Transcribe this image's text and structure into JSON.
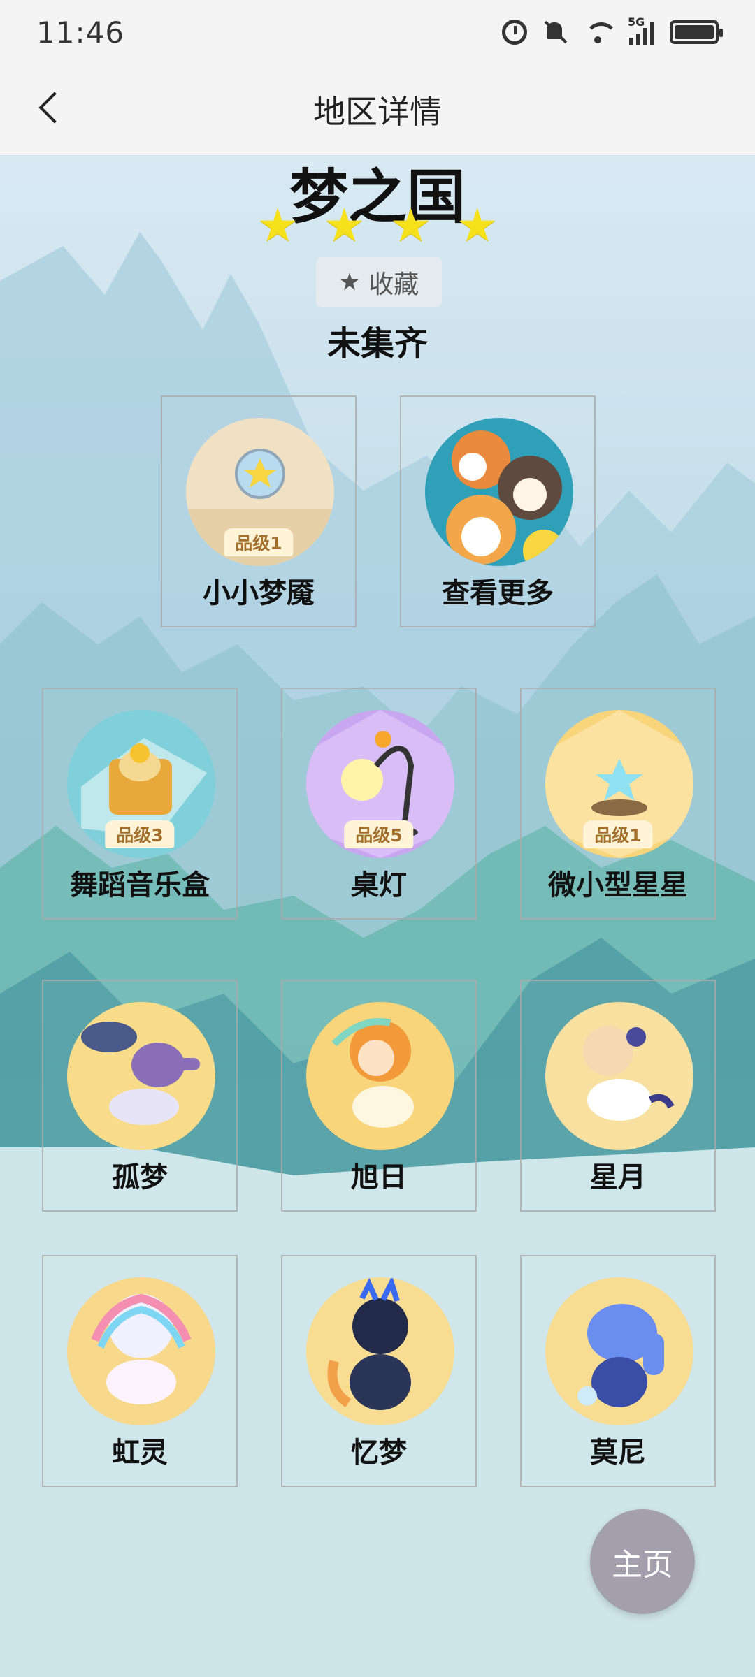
{
  "status_bar": {
    "time": "11:46",
    "network": "5G"
  },
  "nav": {
    "title": "地区详情"
  },
  "region": {
    "name": "梦之国",
    "star_count": 4,
    "star_glyph": "★",
    "collect_status": "未集齐"
  },
  "favorite": {
    "label": "收藏"
  },
  "items": [
    {
      "name": "小小梦魇",
      "badge": "品级1"
    },
    {
      "name": "查看更多",
      "badge": ""
    },
    {
      "name": "舞蹈音乐盒",
      "badge": "品级3"
    },
    {
      "name": "桌灯",
      "badge": "品级5"
    },
    {
      "name": "微小型星星",
      "badge": "品级1"
    },
    {
      "name": "孤梦",
      "badge": ""
    },
    {
      "name": "旭日",
      "badge": ""
    },
    {
      "name": "星月",
      "badge": ""
    },
    {
      "name": "虹灵",
      "badge": ""
    },
    {
      "name": "忆梦",
      "badge": ""
    },
    {
      "name": "莫尼",
      "badge": ""
    }
  ],
  "home_button": {
    "label": "主页"
  },
  "colors": {
    "star": "#f7e11b",
    "home_button": "#a39fad",
    "badge_text": "#a1712d"
  }
}
